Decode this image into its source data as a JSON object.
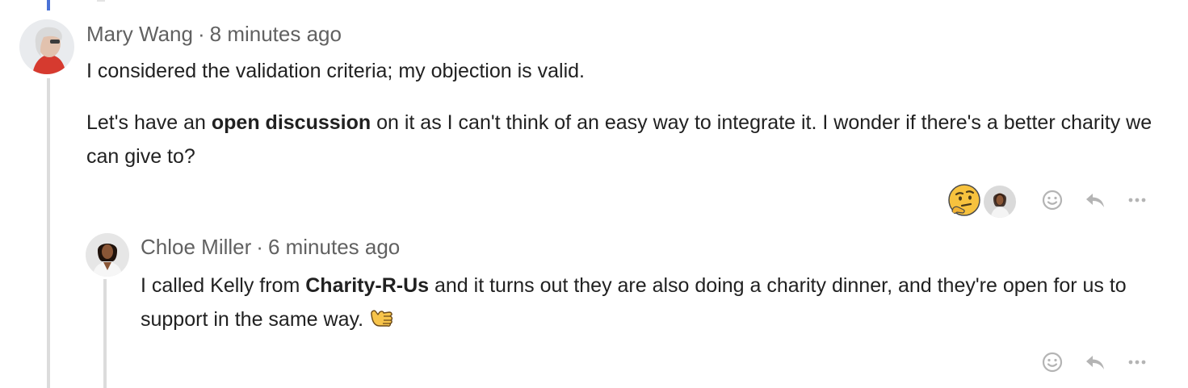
{
  "thread": {
    "comment1": {
      "author": "Mary Wang",
      "separator": "·",
      "time": "8 minutes ago",
      "paragraph1": "I considered the validation criteria; my objection is valid.",
      "paragraph2": {
        "before": "Let's have an ",
        "bold": "open discussion",
        "after": " on it as I can't think of an easy way to integrate it. I wonder if there's a better charity we can give to?"
      },
      "reactions": [
        {
          "icon": "thinking-face-emoji"
        },
        {
          "icon": "reactor-avatar"
        }
      ]
    },
    "comment2": {
      "author": "Chloe Miller",
      "separator": "·",
      "time": "6 minutes ago",
      "text": {
        "before": "I called Kelly from ",
        "bold": "Charity-R-Us",
        "after": " and it turns out they are also doing a charity dinner, and they're open for us to support in the same way."
      },
      "inline_emoji": "call-me-hand-emoji"
    }
  },
  "actions": {
    "icons": [
      "add-reaction-icon",
      "reply-icon",
      "more-options-icon"
    ]
  },
  "colors": {
    "accent": "#4a72d6",
    "thread_line": "#dcdcdc",
    "meta_text": "#616161",
    "icon_gray": "#b4b4b4"
  }
}
